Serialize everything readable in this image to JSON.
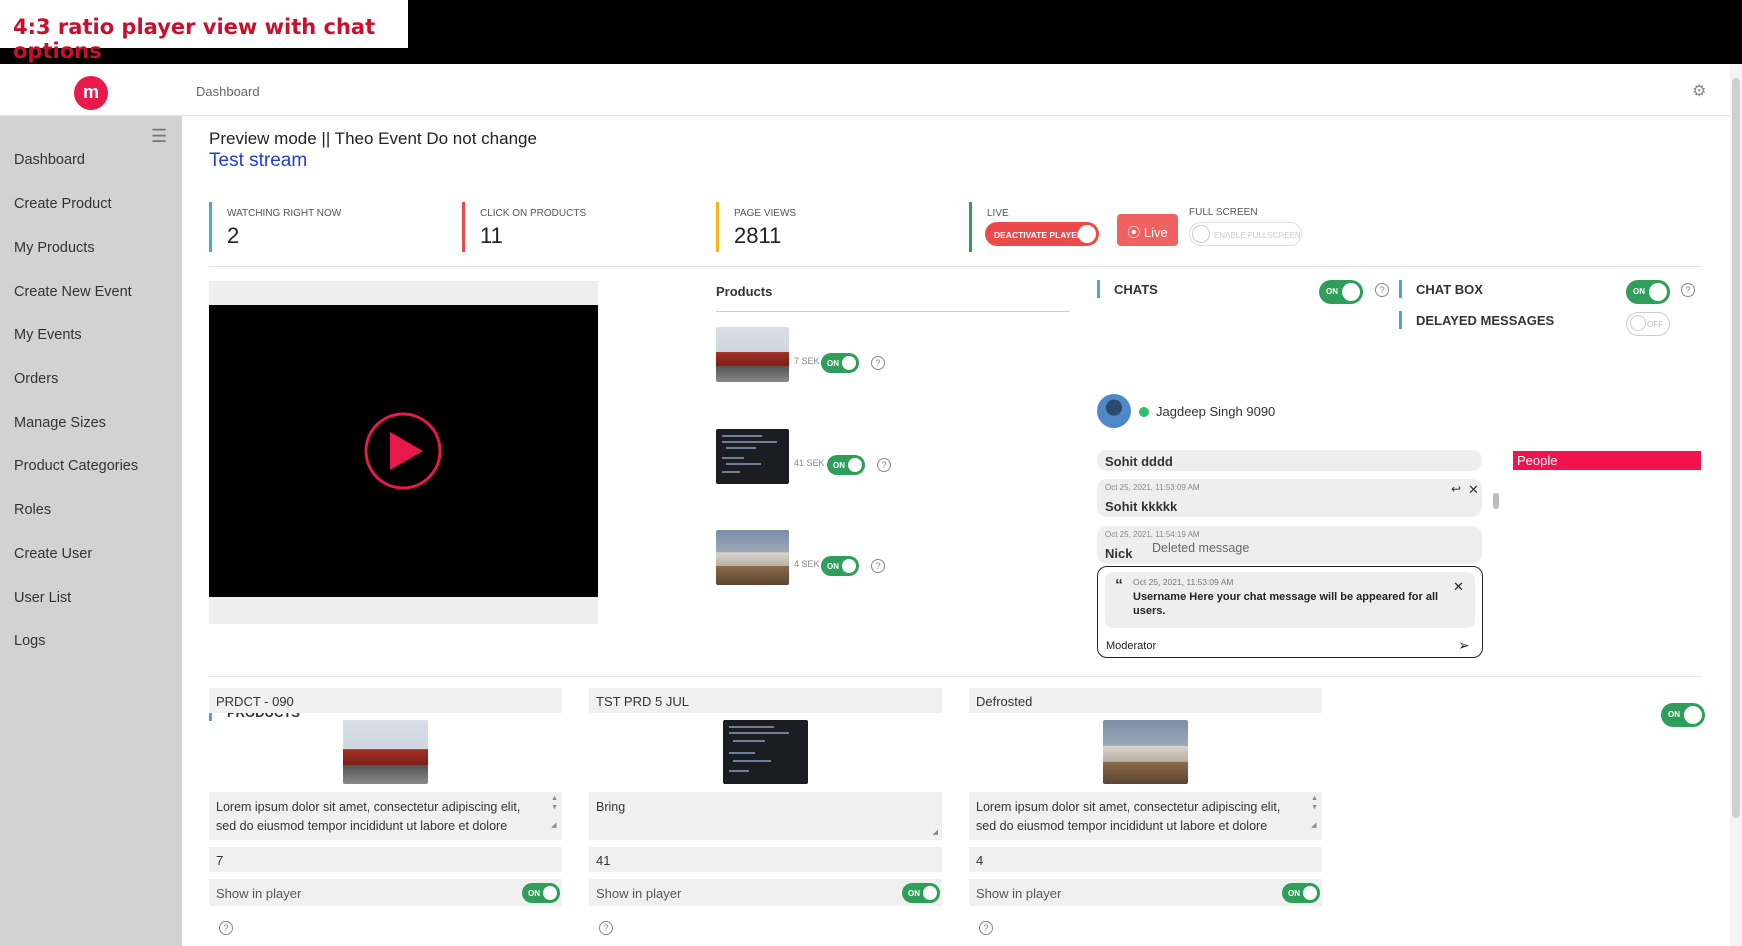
{
  "banner": "4:3 ratio player view  with chat options",
  "topbar": {
    "logo_letter": "m",
    "breadcrumb": "Dashboard",
    "settings_icon": "gear-icon"
  },
  "sidebar": {
    "items": [
      {
        "label": "Dashboard"
      },
      {
        "label": "Create Product"
      },
      {
        "label": "My Products"
      },
      {
        "label": "Create New Event"
      },
      {
        "label": "My Events"
      },
      {
        "label": "Orders"
      },
      {
        "label": "Manage Sizes"
      },
      {
        "label": "Product Categories"
      },
      {
        "label": "Roles"
      },
      {
        "label": "Create User"
      },
      {
        "label": "User List"
      },
      {
        "label": "Logs"
      }
    ]
  },
  "page": {
    "title": "Preview mode || Theo Event Do not change",
    "stream": "Test stream"
  },
  "stats": [
    {
      "label": "WATCHING RIGHT NOW",
      "value": "2",
      "color": "#4aa8c9"
    },
    {
      "label": "CLICK ON PRODUCTS",
      "value": "11",
      "color": "#ea4a4a"
    },
    {
      "label": "PAGE VIEWS",
      "value": "2811",
      "color": "#f2b619"
    },
    {
      "label": "LIVE",
      "value": "",
      "color": "#2e9e5a"
    }
  ],
  "live_controls": {
    "deactivate_label": "DEACTIVATE PLAYER",
    "live_label": "Live",
    "fullscreen_title": "FULL SCREEN",
    "fullscreen_button": "ENABLE FULLSCREEN"
  },
  "player_products": {
    "title": "Products",
    "items": [
      {
        "sek": "7 SEK",
        "toggle": "ON"
      },
      {
        "sek": "41 SEK",
        "toggle": "ON"
      },
      {
        "sek": "4 SEK",
        "toggle": "ON"
      }
    ]
  },
  "chat": {
    "chats_label": "CHATS",
    "chats_toggle": "ON",
    "chatbox_label": "CHAT BOX",
    "chatbox_toggle": "ON",
    "delayed_label": "DELAYED MESSAGES",
    "delayed_toggle": "OFF",
    "user": "Jagdeep Singh 9090",
    "messages": [
      {
        "who": "Sohit dddd",
        "time": "",
        "text": ""
      },
      {
        "who": "Sohit kkkkk",
        "time": "Oct 25, 2021, 11:53:09 AM",
        "text": ""
      },
      {
        "who": "Nick",
        "time": "Oct 25, 2021, 11:54:19 AM",
        "text": "Deleted message"
      }
    ],
    "people_label": "People",
    "reply": {
      "time": "Oct 25, 2021, 11:53:09 AM",
      "text": "Username Here your chat message will be appeared for all users.",
      "input": "Moderator"
    }
  },
  "products_section": {
    "title": "PRODUCTS",
    "toggle": "ON",
    "cards": [
      {
        "name": "PRDCT - 090",
        "desc": "Lorem ipsum dolor sit amet, consectetur adipiscing elit, sed do eiusmod tempor incididunt ut labore et dolore",
        "number": "7",
        "show_label": "Show in player",
        "toggle": "ON"
      },
      {
        "name": "TST PRD 5 JUL",
        "desc": "Bring",
        "number": "41",
        "show_label": "Show in player",
        "toggle": "ON"
      },
      {
        "name": "Defrosted",
        "desc": "Lorem ipsum dolor sit amet, consectetur adipiscing elit, sed do eiusmod tempor incididunt ut labore et dolore",
        "number": "4",
        "show_label": "Show in player",
        "toggle": "ON"
      }
    ]
  },
  "colors": {
    "accent": "#e8194b",
    "toggle_on": "#2e9e5a",
    "link": "#1f3fd1",
    "people": "#f0134d"
  }
}
